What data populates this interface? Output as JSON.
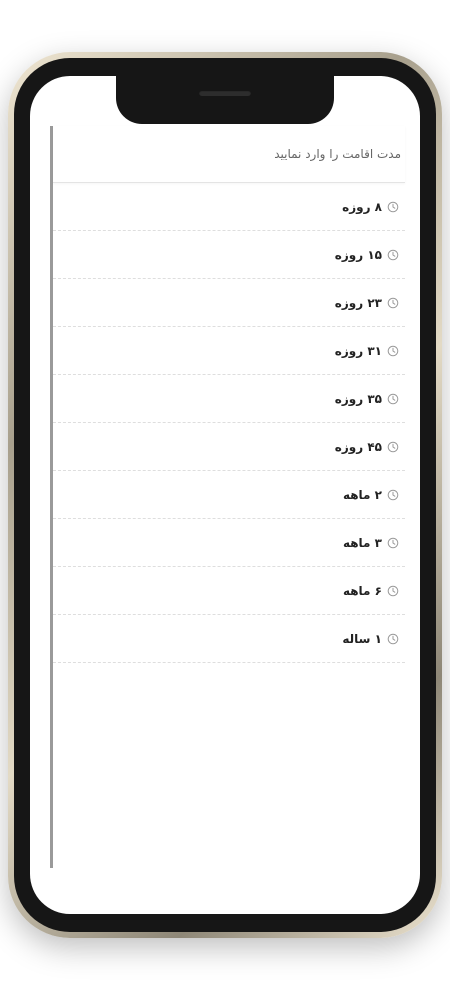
{
  "dropdown": {
    "placeholder": "مدت اقامت را وارد نمایید"
  },
  "options": [
    {
      "label": "۸ روزه",
      "icon": "clock-icon"
    },
    {
      "label": "۱۵ روزه",
      "icon": "clock-icon"
    },
    {
      "label": "۲۳ روزه",
      "icon": "clock-icon"
    },
    {
      "label": "۳۱ روزه",
      "icon": "clock-icon"
    },
    {
      "label": "۳۵ روزه",
      "icon": "clock-icon"
    },
    {
      "label": "۴۵ روزه",
      "icon": "clock-icon"
    },
    {
      "label": "۲ ماهه",
      "icon": "clock-icon"
    },
    {
      "label": "۳ ماهه",
      "icon": "clock-icon"
    },
    {
      "label": "۶ ماهه",
      "icon": "clock-icon"
    },
    {
      "label": "۱ ساله",
      "icon": "clock-icon"
    }
  ],
  "colors": {
    "frame": "#161616",
    "text": "#222222",
    "placeholder": "#666666",
    "icon": "#9a9a9a"
  }
}
